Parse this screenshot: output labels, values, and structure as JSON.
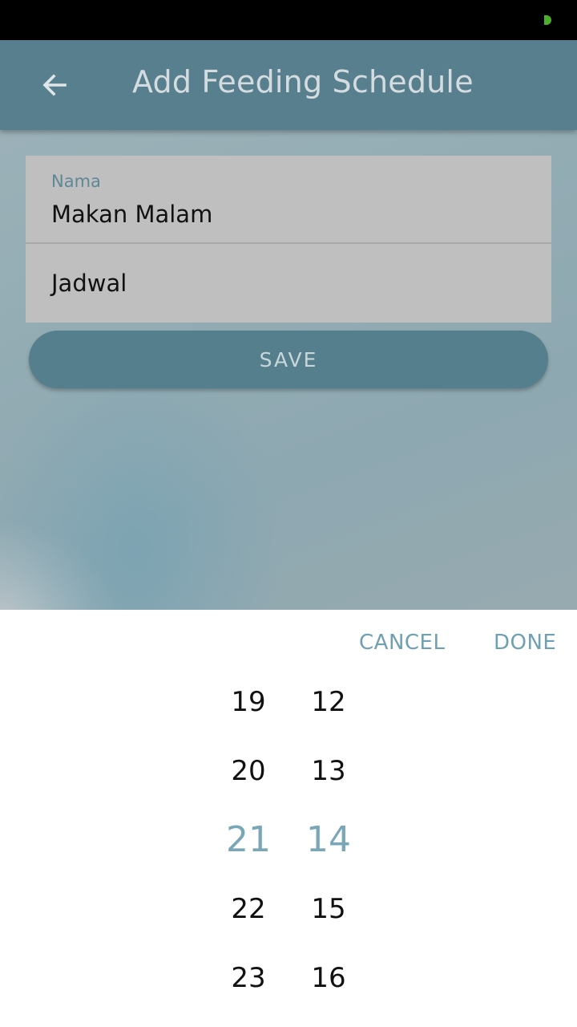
{
  "app_bar": {
    "title": "Add Feeding Schedule"
  },
  "form": {
    "name_label": "Nama",
    "name_value": "Makan Malam",
    "schedule_placeholder": "Jadwal",
    "save_label": "SAVE"
  },
  "time_picker": {
    "cancel_label": "CANCEL",
    "done_label": "DONE",
    "hours": [
      "19",
      "20",
      "21",
      "22",
      "23"
    ],
    "minutes": [
      "12",
      "13",
      "14",
      "15",
      "16"
    ],
    "selected_hour": "21",
    "selected_minute": "14"
  },
  "colors": {
    "app_bar": "#587f8e",
    "accent": "#7aa7b7",
    "status_indicator": "#4caf2a"
  }
}
